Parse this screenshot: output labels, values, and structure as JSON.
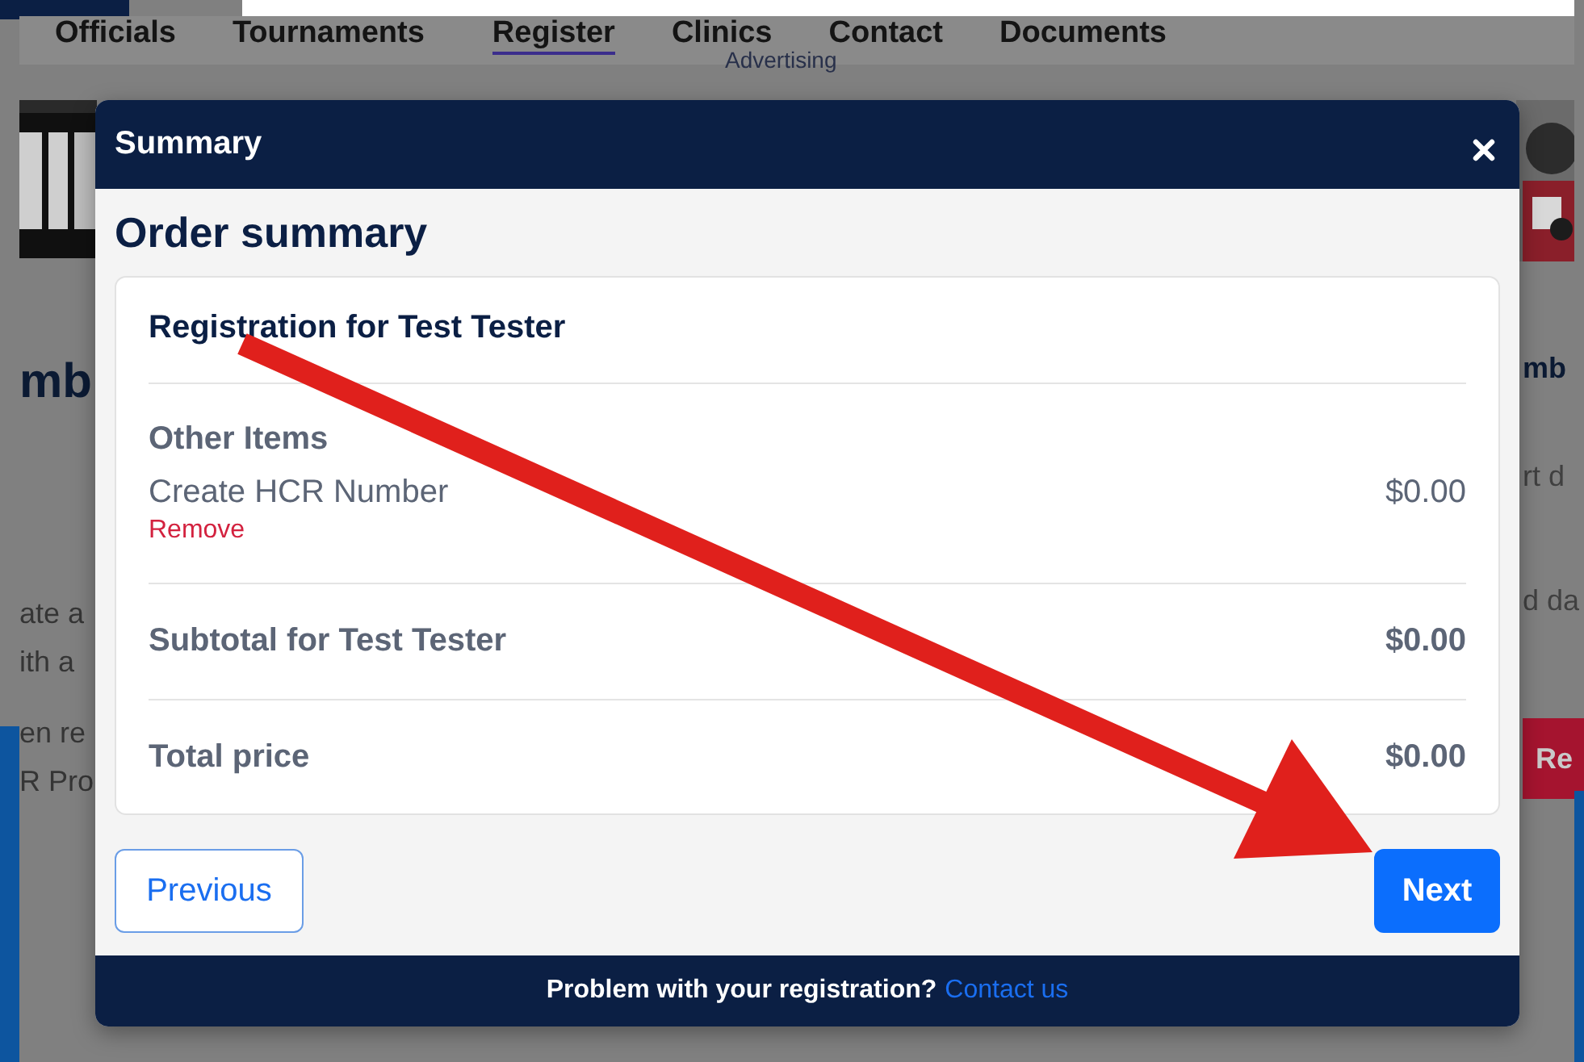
{
  "nav": {
    "items": [
      {
        "label": "Officials",
        "selected": false
      },
      {
        "label": "Tournaments",
        "selected": false
      },
      {
        "label": "Register",
        "selected": true
      },
      {
        "label": "Clinics",
        "selected": false
      },
      {
        "label": "Contact",
        "selected": false
      },
      {
        "label": "Documents",
        "selected": false
      }
    ],
    "subtext": "Advertising"
  },
  "page_behind": {
    "left_heading": "mb",
    "left_lines": [
      "ate a",
      "ith a",
      "en re",
      "R Pro"
    ],
    "right_heading": "mb",
    "right_lines": [
      "rt d",
      "d da"
    ],
    "right_button": "Re"
  },
  "modal": {
    "title": "Summary",
    "heading": "Order summary",
    "card": {
      "title": "Registration for Test Tester",
      "section": "Other Items",
      "items": [
        {
          "name": "Create HCR Number",
          "price": "$0.00",
          "action": "Remove"
        }
      ],
      "subtotal": {
        "label": "Subtotal for Test Tester",
        "amount": "$0.00"
      },
      "total": {
        "label": "Total price",
        "amount": "$0.00"
      }
    },
    "buttons": [
      {
        "label": "Previous",
        "kind": "secondary"
      },
      {
        "label": "Next",
        "kind": "primary"
      }
    ],
    "footer": {
      "text": "Problem with your registration?",
      "link": "Contact us"
    }
  }
}
